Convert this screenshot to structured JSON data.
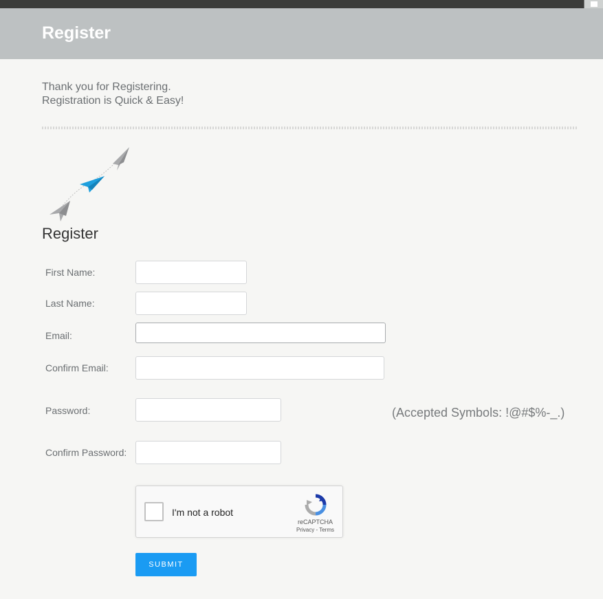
{
  "header": {
    "title": "Register"
  },
  "intro": {
    "line1": "Thank you for Registering.",
    "line2": "Registration is Quick & Easy!"
  },
  "section": {
    "title": "Register"
  },
  "form": {
    "first_name_label": "First Name:",
    "last_name_label": "Last Name:",
    "email_label": "Email:",
    "confirm_email_label": "Confirm Email:",
    "password_label": "Password:",
    "confirm_password_label": "Confirm Password:",
    "first_name_value": "",
    "last_name_value": "",
    "email_value": "",
    "confirm_email_value": "",
    "password_value": "",
    "confirm_password_value": "",
    "password_hint": "(Accepted Symbols: !@#$%-_.)",
    "submit_label": "SUBMIT"
  },
  "captcha": {
    "label": "I'm not a robot",
    "brand": "reCAPTCHA",
    "links": "Privacy - Terms"
  },
  "colors": {
    "banner": "#bdc1c2",
    "accent": "#1a9bf3",
    "plane_blue": "#1e9fdd",
    "plane_gray": "#a8a9ab"
  },
  "icons": {
    "planes": "paper-planes-illustration",
    "captcha": "recaptcha-logo-icon"
  }
}
